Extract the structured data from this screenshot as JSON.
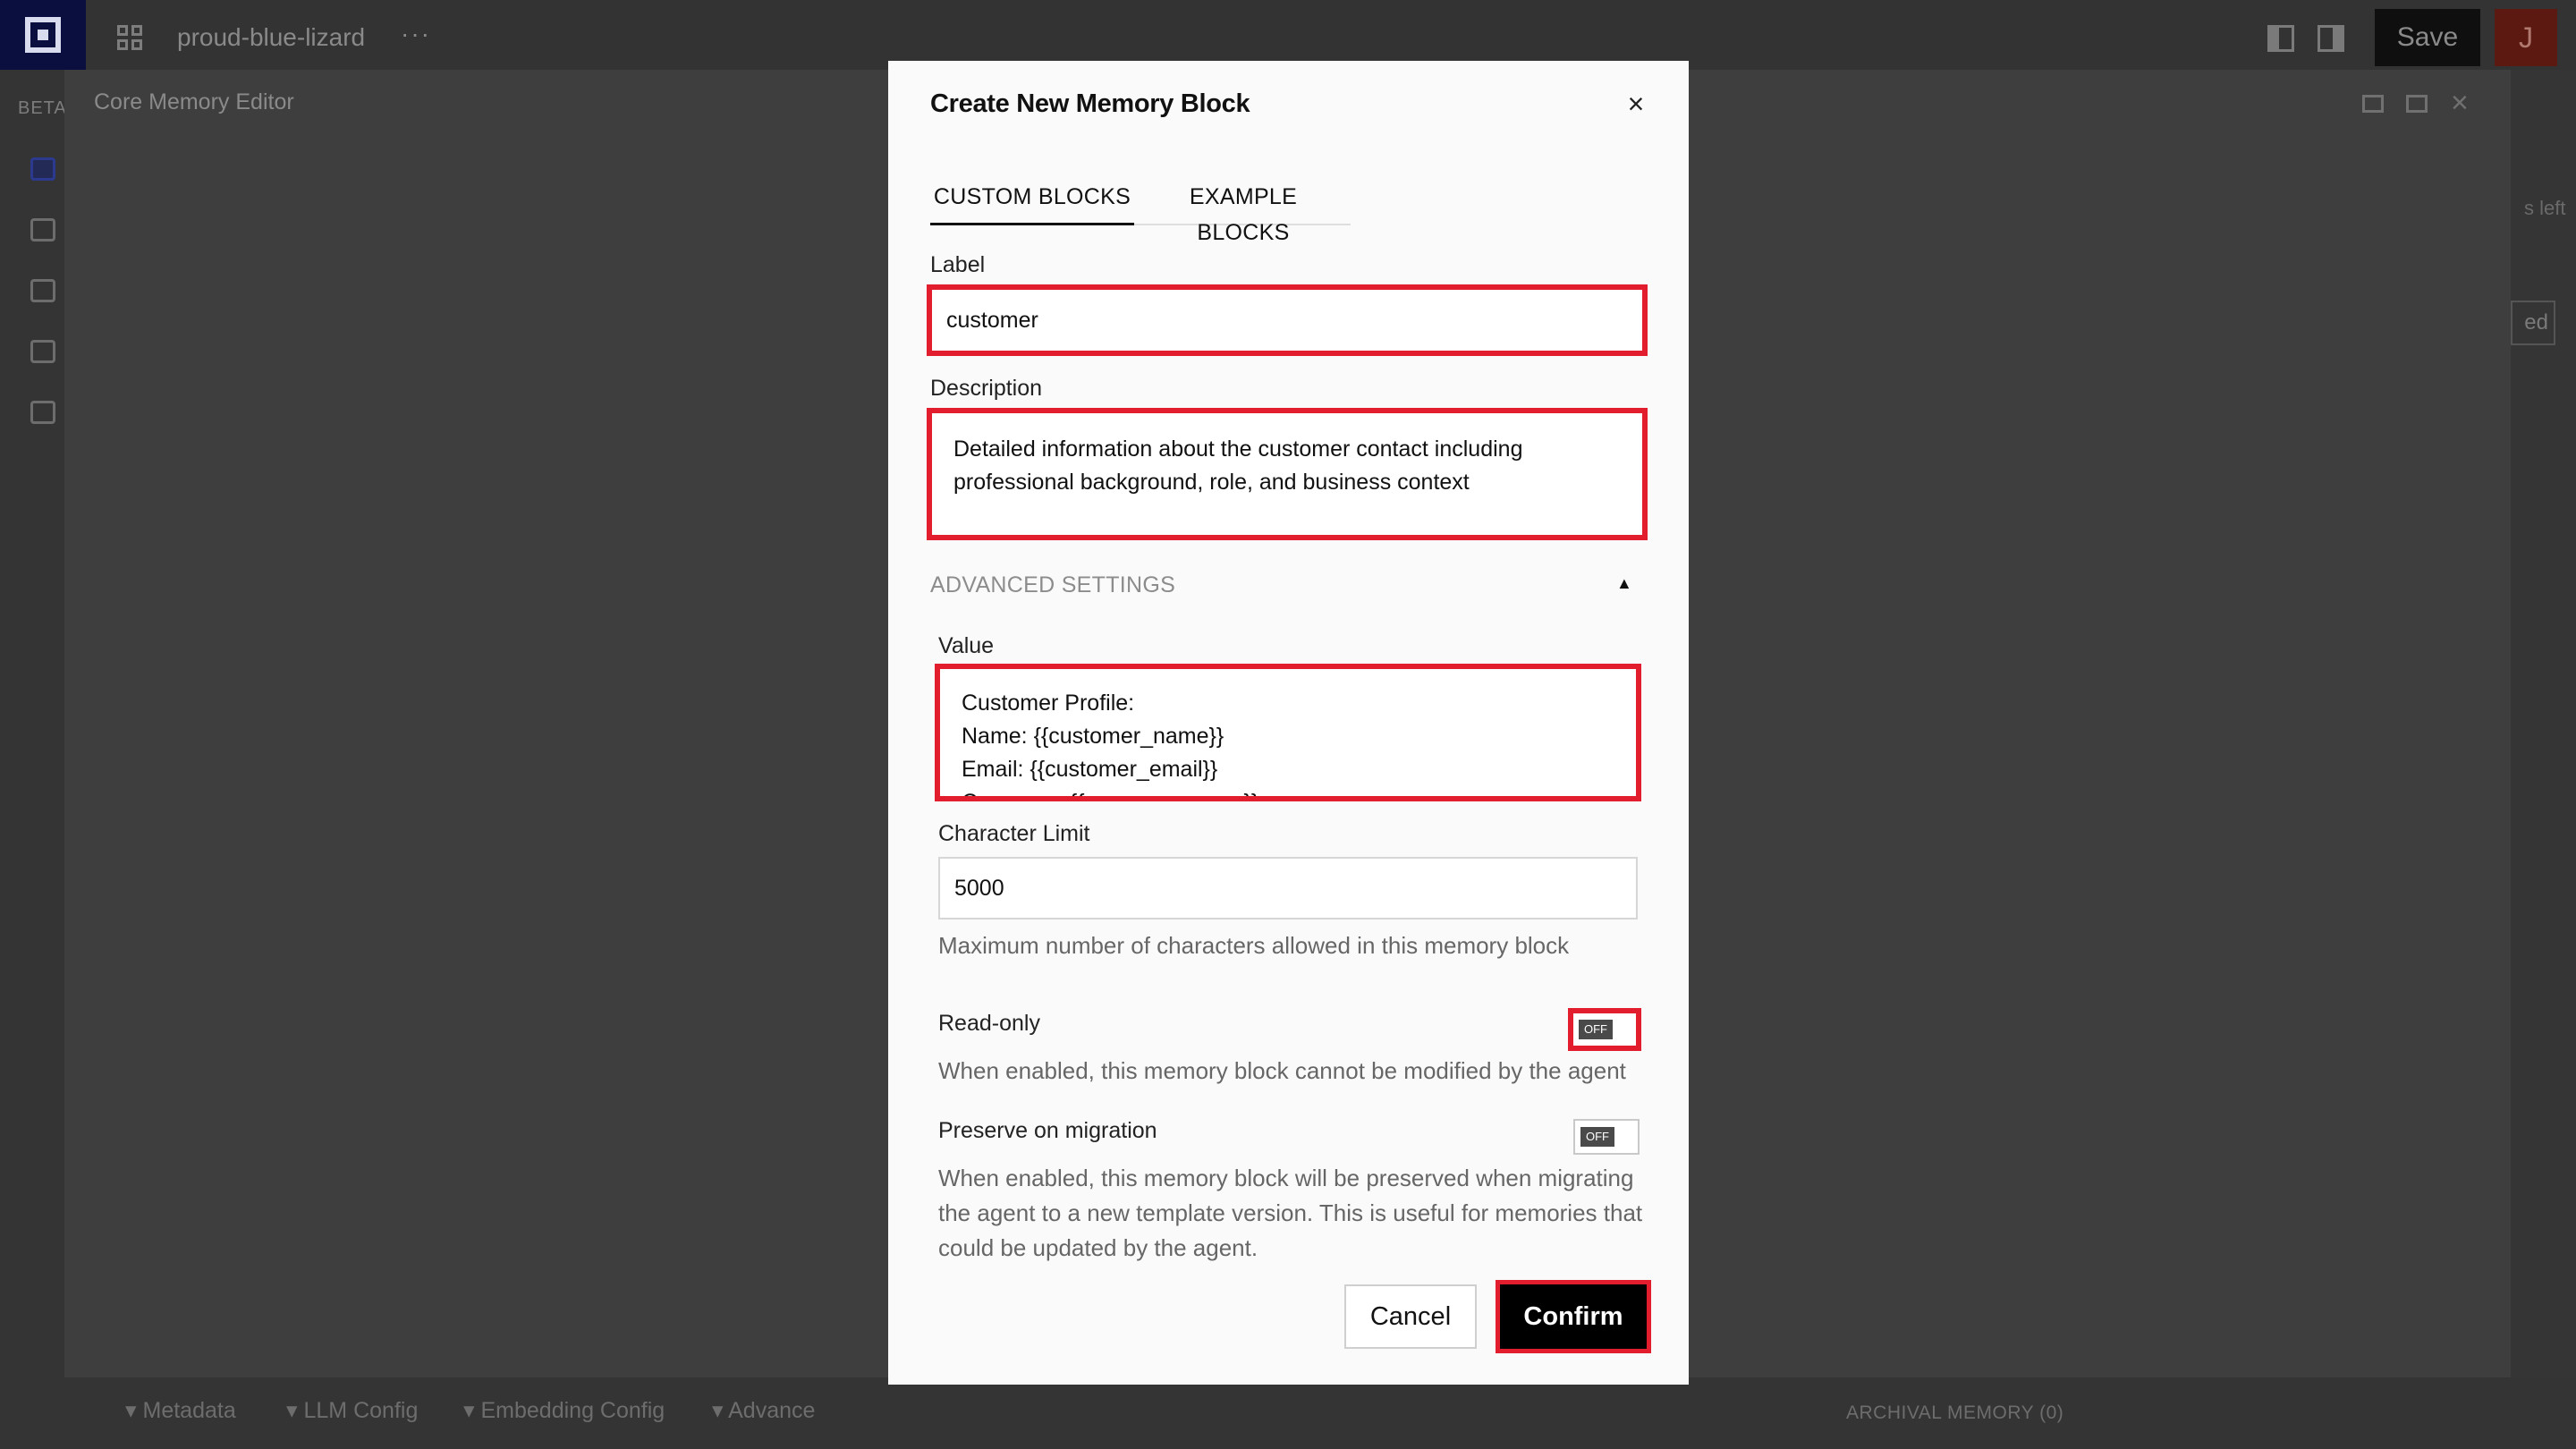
{
  "app": {
    "project_name": "proud-blue-lizard",
    "more": "···",
    "save_label": "Save",
    "avatar_initial": "J",
    "beta_label": "BETA",
    "editor_title": "Core Memory Editor",
    "right_strip": {
      "fragment_left": "s left",
      "fragment_ed": "ed"
    }
  },
  "bottom_tabs": [
    "Metadata",
    "LLM Config",
    "Embedding Config",
    "Advance"
  ],
  "archival_label": "ARCHIVAL MEMORY (0)",
  "modal": {
    "title": "Create New Memory Block",
    "close": "×",
    "tabs": [
      {
        "label": "CUSTOM BLOCKS",
        "active": true
      },
      {
        "label": "EXAMPLE BLOCKS",
        "active": false
      }
    ],
    "label_field": {
      "label": "Label",
      "value": "customer"
    },
    "description_field": {
      "label": "Description",
      "value": "Detailed information about the customer contact including professional background, role, and business context"
    },
    "advanced": {
      "header": "ADVANCED SETTINGS",
      "caret": "▲"
    },
    "value_field": {
      "label": "Value",
      "lines": [
        "Customer Profile:",
        "Name: {{customer_name}}",
        "Email: {{customer_email}}",
        "Company: {{company_name}}"
      ]
    },
    "limit_field": {
      "label": "Character Limit",
      "value": "5000",
      "help": "Maximum number of characters allowed in this memory block"
    },
    "read_only": {
      "label": "Read-only",
      "state": "OFF",
      "help": "When enabled, this memory block cannot be modified by the agent"
    },
    "preserve": {
      "label": "Preserve on migration",
      "state": "OFF",
      "help": "When enabled, this memory block will be preserved when migrating the agent to a new template version. This is useful for memories that could be updated by the agent."
    },
    "cancel_label": "Cancel",
    "confirm_label": "Confirm"
  },
  "colors": {
    "highlight": "#e11d2e",
    "overlay": "#3a3a3a",
    "modal_bg": "#fafafa",
    "brand": "#0b0f3f"
  }
}
